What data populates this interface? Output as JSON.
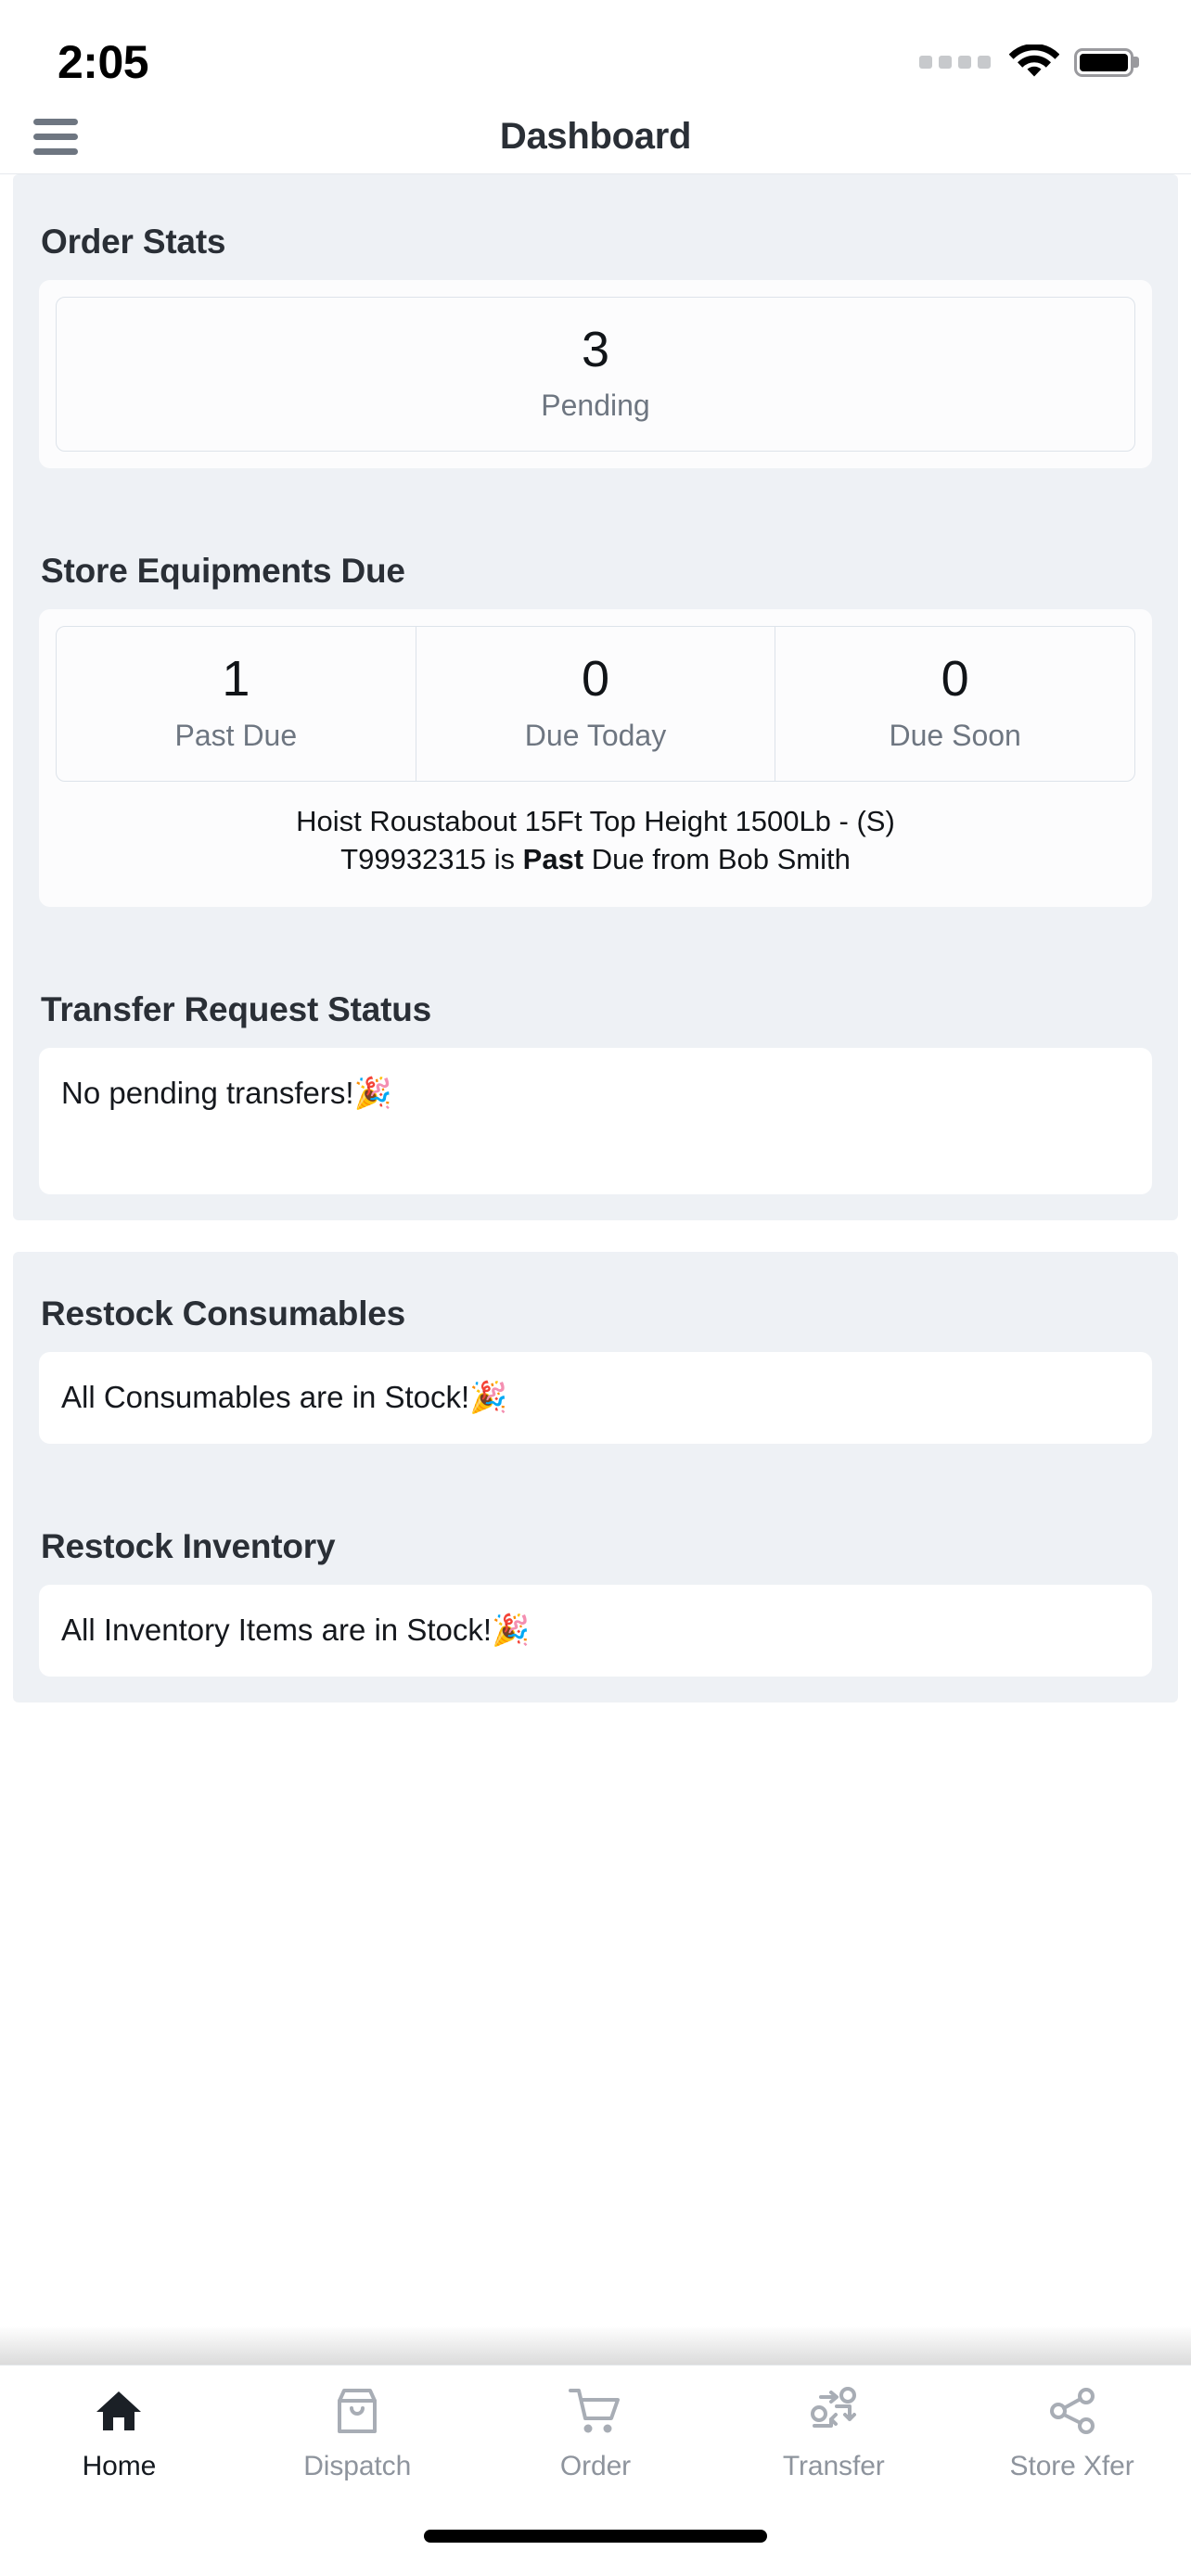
{
  "status_bar": {
    "time": "2:05",
    "signal_icon": "signal-dots-icon",
    "wifi_icon": "wifi-icon",
    "battery_icon": "battery-full-icon"
  },
  "nav": {
    "menu_icon": "hamburger-menu-icon",
    "title": "Dashboard"
  },
  "sections": {
    "order_stats": {
      "title": "Order Stats",
      "stats": [
        {
          "value": "3",
          "label": "Pending"
        }
      ]
    },
    "store_equipments_due": {
      "title": "Store Equipments Due",
      "stats": [
        {
          "value": "1",
          "label": "Past Due"
        },
        {
          "value": "0",
          "label": "Due Today"
        },
        {
          "value": "0",
          "label": "Due Soon"
        }
      ],
      "note_line1": "Hoist Roustabout 15Ft Top Height 1500Lb - (S)",
      "note_line2_pre": "T99932315 is ",
      "note_line2_bold": "Past",
      "note_line2_post": " Due from Bob Smith"
    },
    "transfer_request_status": {
      "title": "Transfer Request Status",
      "message": "No pending transfers! ",
      "emoji": "🎉"
    },
    "restock_consumables": {
      "title": "Restock Consumables",
      "message": "All Consumables are in Stock! ",
      "emoji": "🎉"
    },
    "restock_inventory": {
      "title": "Restock Inventory",
      "message": "All Inventory Items are in Stock! ",
      "emoji": "🎉"
    }
  },
  "tab_bar": {
    "tabs": [
      {
        "label": "Home",
        "icon": "home-icon",
        "active": true
      },
      {
        "label": "Dispatch",
        "icon": "shopping-bag-icon",
        "active": false
      },
      {
        "label": "Order",
        "icon": "shopping-cart-icon",
        "active": false
      },
      {
        "label": "Transfer",
        "icon": "transfer-nodes-icon",
        "active": false
      },
      {
        "label": "Store Xfer",
        "icon": "share-nodes-icon",
        "active": false
      }
    ]
  },
  "colors": {
    "section_bg": "#eef1f5",
    "card_bg": "#fcfcfd",
    "text_primary": "#2a2f36",
    "text_muted": "#6e7681",
    "tab_inactive": "#8e949d",
    "tab_active": "#151a20",
    "divider": "#dde3ea"
  }
}
